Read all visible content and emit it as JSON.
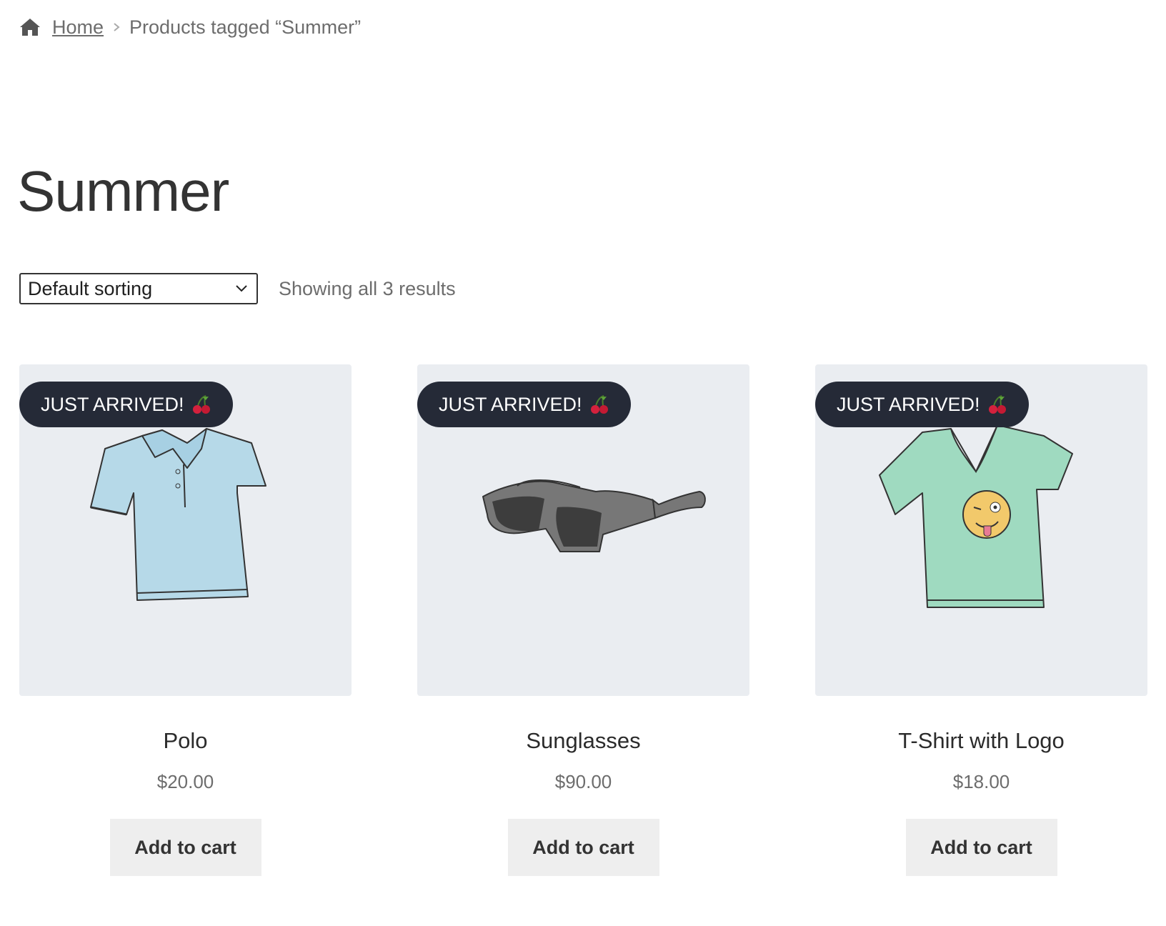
{
  "breadcrumb": {
    "home_label": "Home",
    "current": "Products tagged “Summer”"
  },
  "page_title": "Summer",
  "toolbar": {
    "sort_selected": "Default sorting",
    "result_count": "Showing all 3 results"
  },
  "products": [
    {
      "badge": "JUST ARRIVED!",
      "name": "Polo",
      "price": "$20.00",
      "button": "Add to cart",
      "image": "blue-polo-shirt"
    },
    {
      "badge": "JUST ARRIVED!",
      "name": "Sunglasses",
      "price": "$90.00",
      "button": "Add to cart",
      "image": "sunglasses"
    },
    {
      "badge": "JUST ARRIVED!",
      "name": "T-Shirt with Logo",
      "price": "$18.00",
      "button": "Add to cart",
      "image": "green-tshirt-with-emoji"
    }
  ],
  "colors": {
    "badge_bg": "#252a37",
    "image_bg": "#eaedf1",
    "button_bg": "#eeeeee"
  }
}
